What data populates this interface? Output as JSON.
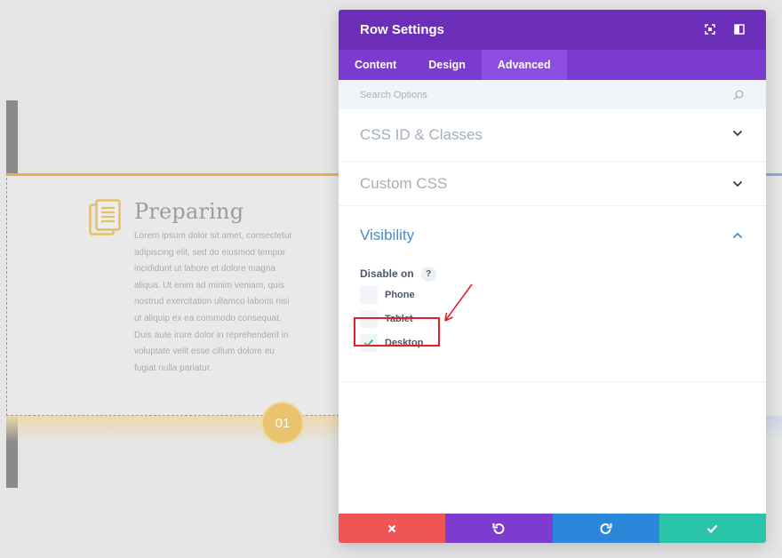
{
  "background": {
    "module": {
      "icon": "document-icon",
      "title": "Preparing",
      "body": "Lorem ipsum dolor sit amet, consectetur adipiscing elit, sed do eiusmod tempor incididunt ut labore et dolore magna aliqua. Ut enim ad minim veniam, quis nostrud exercitation ullamco laboris nisi ut aliquip ex ea commodo consequat. Duis aute irure dolor in reprehenderit in voluptate velit esse cillum dolore eu fugiat nulla pariatur.",
      "step_number": "01"
    }
  },
  "modal": {
    "title": "Row Settings",
    "header_icons": [
      "expand-icon",
      "split-view-icon"
    ],
    "tabs": [
      {
        "label": "Content",
        "active": false
      },
      {
        "label": "Design",
        "active": false
      },
      {
        "label": "Advanced",
        "active": true
      }
    ],
    "search": {
      "placeholder": "Search Options",
      "value": ""
    },
    "sections": {
      "css_id": {
        "label": "CSS ID & Classes",
        "expanded": false
      },
      "custom_css": {
        "label": "Custom CSS",
        "expanded": false
      },
      "visibility": {
        "label": "Visibility",
        "expanded": true,
        "disable_on_label": "Disable on",
        "help": "?",
        "options": [
          {
            "label": "Phone",
            "checked": false
          },
          {
            "label": "Tablet",
            "checked": false
          },
          {
            "label": "Desktop",
            "checked": true
          }
        ]
      }
    },
    "footer": [
      "cancel-icon",
      "undo-icon",
      "redo-icon",
      "save-icon"
    ]
  },
  "colors": {
    "header": "#6c2eb9",
    "tabs": "#7b3bd0",
    "active_tab": "#8e4de2",
    "link_blue": "#3d8fd8",
    "cancel": "#ef5555",
    "undo": "#7e3bd0",
    "redo": "#2b87da",
    "save": "#29c4a9",
    "annotation_red": "#e0202a"
  }
}
